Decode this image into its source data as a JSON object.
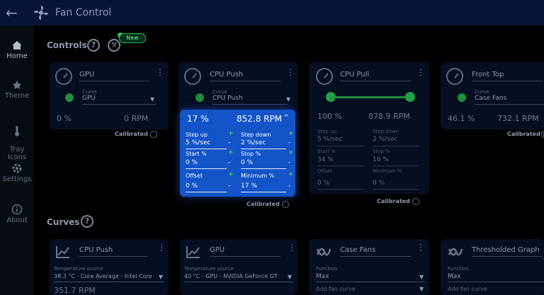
{
  "window": {
    "title": "Fan Control"
  },
  "nav": [
    {
      "label": "Home",
      "icon": "home-icon"
    },
    {
      "label": "Theme",
      "icon": "palette-icon"
    },
    {
      "label": "Tray\nIcons",
      "icon": "thermometer-icon"
    },
    {
      "label": "Settings",
      "icon": "gear-icon"
    },
    {
      "label": "About",
      "icon": "info-icon"
    }
  ],
  "controls": {
    "title": "Controls",
    "badge": "New",
    "cards": [
      {
        "name": "GPU",
        "sensor_label": "Curve",
        "sensor": "GPU",
        "percent": "0 %",
        "rpm": "0 RPM",
        "calibrated": "Calibrated"
      },
      {
        "name": "CPU Push",
        "sensor_label": "Curve",
        "sensor": "CPU Push",
        "calibrated": "Calibrated"
      },
      {
        "name": "CPU Pull",
        "percent": "100 %",
        "rpm": "878.9 RPM",
        "calibrated": "Calibrated",
        "step_up": "5 %/sec",
        "step_down": "2 %/sec",
        "start": "34 %",
        "stop": "16 %",
        "offset": "0 %",
        "minimum": "0 %",
        "step_up_label": "Step up",
        "step_down_label": "Step down",
        "start_label": "Start %",
        "stop_label": "Stop %",
        "offset_label": "Offset",
        "minimum_label": "Minimum %",
        "slider_fraction": 1.0
      },
      {
        "name": "Front Top",
        "sensor_label": "Curve",
        "sensor": "Case Fans",
        "percent": "46.1 %",
        "rpm": "732.1 RPM",
        "calibrated": "Calibrated"
      }
    ],
    "popup": {
      "percent": "17 %",
      "rpm": "852.8 RPM",
      "step_up_label": "Step up",
      "step_up": "5 %/sec",
      "step_down_label": "Step down",
      "step_down": "2 %/sec",
      "start_label": "Start %",
      "start": "0 %",
      "stop_label": "Stop %",
      "stop": "0 %",
      "offset_label": "Offset",
      "offset": "0 %",
      "minimum_label": "Minimum %",
      "minimum": "17 %"
    }
  },
  "curves": {
    "title": "Curves",
    "cards": [
      {
        "name": "CPU Push",
        "sensor_label": "Temperature source",
        "sensor": "38.3 °C - Core Average - Intel Core",
        "value": "351.7 RPM"
      },
      {
        "name": "GPU",
        "sensor_label": "Temperature source",
        "sensor": "40 °C - GPU - NVIDIA GeForce GT"
      },
      {
        "name": "Case Fans",
        "sensor_label": "Function",
        "sensor": "Max",
        "add": "Add fan curve"
      },
      {
        "name": "Thresholded Graph",
        "sensor_label": "Function",
        "sensor": "Max",
        "add": "Add fan curve"
      }
    ]
  },
  "colors": {
    "accent": "#1354c8",
    "toggle": "#1f8f3a",
    "titlebar": "#071633"
  }
}
